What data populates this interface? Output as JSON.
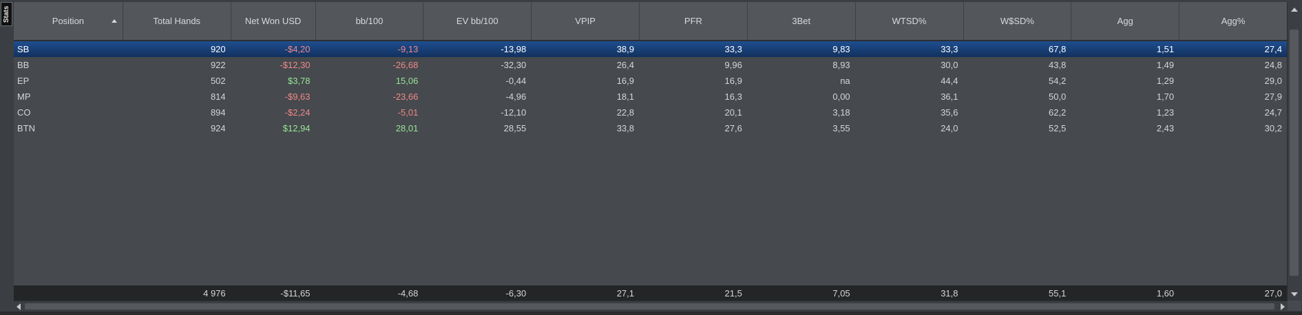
{
  "side_tab": {
    "label": "Stats"
  },
  "columns": [
    {
      "label": "Position",
      "sorted": true
    },
    {
      "label": "Total Hands"
    },
    {
      "label": "Net Won USD"
    },
    {
      "label": "bb/100"
    },
    {
      "label": "EV bb/100"
    },
    {
      "label": "VPIP"
    },
    {
      "label": "PFR"
    },
    {
      "label": "3Bet"
    },
    {
      "label": "WTSD%"
    },
    {
      "label": "W$SD%"
    },
    {
      "label": "Agg"
    },
    {
      "label": "Agg%"
    }
  ],
  "rows": [
    {
      "cells": [
        "SB",
        "920",
        "-$4,20",
        "-9,13",
        "-13,98",
        "38,9",
        "33,3",
        "9,83",
        "33,3",
        "67,8",
        "1,51",
        "27,4"
      ],
      "selected": true
    },
    {
      "cells": [
        "BB",
        "922",
        "-$12,30",
        "-26,68",
        "-32,30",
        "26,4",
        "9,96",
        "8,93",
        "30,0",
        "43,8",
        "1,49",
        "24,8"
      ]
    },
    {
      "cells": [
        "EP",
        "502",
        "$3,78",
        "15,06",
        "-0,44",
        "16,9",
        "16,9",
        "na",
        "44,4",
        "54,2",
        "1,29",
        "29,0"
      ]
    },
    {
      "cells": [
        "MP",
        "814",
        "-$9,63",
        "-23,66",
        "-4,96",
        "18,1",
        "16,3",
        "0,00",
        "36,1",
        "50,0",
        "1,70",
        "27,9"
      ]
    },
    {
      "cells": [
        "CO",
        "894",
        "-$2,24",
        "-5,01",
        "-12,10",
        "22,8",
        "20,1",
        "3,18",
        "35,6",
        "62,2",
        "1,23",
        "24,7"
      ]
    },
    {
      "cells": [
        "BTN",
        "924",
        "$12,94",
        "28,01",
        "28,55",
        "33,8",
        "27,6",
        "3,55",
        "24,0",
        "52,5",
        "2,43",
        "30,2"
      ]
    }
  ],
  "totals": [
    "",
    "4 976",
    "-$11,65",
    "-4,68",
    "-6,30",
    "27,1",
    "21,5",
    "7,05",
    "31,8",
    "55,1",
    "1,60",
    "27,0"
  ],
  "colors": {
    "negative": "#f08a8a",
    "positive": "#98e698",
    "selected_row": "#1f4e8f",
    "header_bg": "#53575b",
    "footer_bg": "#232527"
  }
}
